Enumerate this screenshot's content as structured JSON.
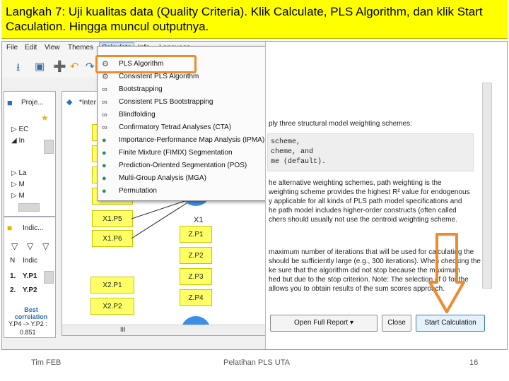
{
  "slide": {
    "title": "Langkah 7:  Uji kualitas data (Quality Criteria). Klik Calculate, PLS Algorithm, dan klik Start Caculation. Hingga muncul outputnya.",
    "footer_left": "Tim FEB",
    "footer_center": "Pelatihan PLS UTA",
    "page_number": "16"
  },
  "menubar": [
    "File",
    "Edit",
    "View",
    "Themes",
    "Calculate",
    "Info",
    "Language"
  ],
  "calculate_menu": [
    {
      "label": "PLS Algorithm",
      "icon": "gear-icon"
    },
    {
      "label": "Consistent PLS Algorithm",
      "icon": "gear-icon"
    },
    {
      "label": "Bootstrapping",
      "icon": "loop-icon"
    },
    {
      "label": "Consistent PLS Bootstrapping",
      "icon": "loop-icon"
    },
    {
      "label": "Blindfolding",
      "icon": "loop-icon"
    },
    {
      "label": "Confirmatory Tetrad Analyses (CTA)",
      "icon": "loop-icon"
    },
    {
      "label": "Importance-Performance Map Analysis (IPMA)",
      "icon": "globe-icon"
    },
    {
      "label": "Finite Mixture (FIMIX) Segmentation",
      "icon": "globe-icon"
    },
    {
      "label": "Prediction-Oriented Segmentation (POS)",
      "icon": "globe-icon"
    },
    {
      "label": "Multi-Group Analysis (MGA)",
      "icon": "globe-icon"
    },
    {
      "label": "Permutation",
      "icon": "globe-icon"
    }
  ],
  "left_panel": {
    "project_tab": "Proje...",
    "tree_items": [
      "EC",
      "In",
      "La",
      "M",
      "M"
    ],
    "indicator_tab": "Indic...",
    "table_header": [
      "N",
      "Indic"
    ],
    "table_rows": [
      [
        "1.",
        "Y.P1"
      ],
      [
        "2.",
        "Y.P2"
      ]
    ],
    "best_correlation_label": "Best correlation",
    "best_correlation_pair": "Y.P4 -> Y.P2 :",
    "best_correlation_value": "0.851"
  },
  "canvas": {
    "tab_label": "*Inter",
    "left_indicators": [
      "X1.P5",
      "X1.P6",
      "X2.P1",
      "X2.P2"
    ],
    "construct_label": "X1",
    "right_indicators": [
      "Z.P1",
      "Z.P2",
      "Z.P3",
      "Z.P4"
    ],
    "horizontal_scroll_label": "III"
  },
  "dialog": {
    "text_lines_top": [
      "ply three structural model weighting schemes:"
    ],
    "code_lines": [
      "scheme,",
      "cheme, and",
      "me (default)."
    ],
    "text_lines_mid": [
      "he alternative weighting schemes, path weighting is the",
      "weighting scheme provides the highest R² value for endogenous",
      "y applicable for all kinds of PLS path model specifications and",
      "he path model includes higher-order constructs (often called",
      "chers should usually not use the centroid weighting scheme."
    ],
    "text_lines_bottom": [
      "maximum number of iterations that will be used for calculating the",
      "should be sufficiently large (e.g., 300 iterations). When checking the",
      "ke sure that the algorithm did not stop because the maximum",
      "hed but due to the stop criterion. Note: The selection of 0 for the",
      "allows you to obtain results of the sum scores approach."
    ],
    "btn_report": "Open Full Report",
    "btn_close": "Close",
    "btn_start": "Start Calculation"
  },
  "colors": {
    "title_bg": "#ffff00",
    "highlight": "#ef8a2f",
    "construct": "#3a8fe8",
    "indicator": "#ffff66"
  }
}
